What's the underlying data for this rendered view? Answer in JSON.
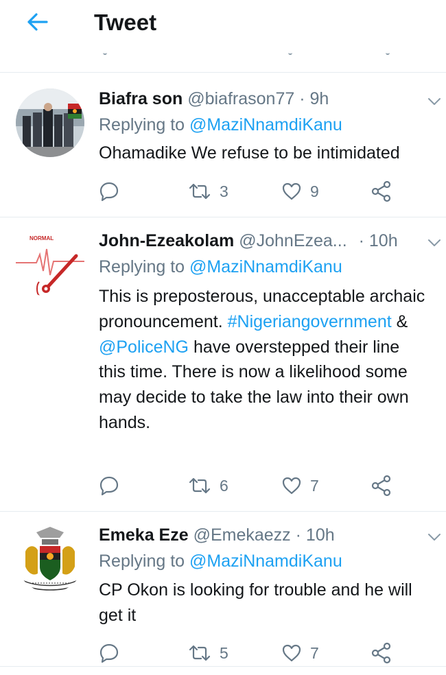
{
  "header": {
    "title": "Tweet",
    "back_icon": "arrow-left-icon"
  },
  "colors": {
    "accent": "#1da1f2",
    "muted": "#657786",
    "text": "#14171a",
    "divider": "#e6ecf0"
  },
  "tweets": [
    {
      "name": "Biafra son",
      "handle": "@biafrason77",
      "time": "· 9h",
      "replying_prefix": "Replying to",
      "replying_to": "@MaziNnamdiKanu",
      "text": "Ohamadike We refuse to be intimidated",
      "replies": "",
      "retweets": "3",
      "likes": "9"
    },
    {
      "name": "John-Ezeakolam",
      "handle": "@JohnEzea...",
      "time": "· 10h",
      "replying_prefix": "Replying to",
      "replying_to": "@MaziNnamdiKanu",
      "text_1": "This is preposterous, unacceptable archaic pronouncement.",
      "hashtag": "#Nigeriangovernment",
      "amp": "&",
      "mention": "@PoliceNG",
      "text_2": "have overstepped their line this time. There is now a likelihood some may decide to take the law into their own hands.",
      "avatar_label": "NORMAL",
      "replies": "",
      "retweets": "6",
      "likes": "7"
    },
    {
      "name": "Emeka Eze",
      "handle": "@Emekaezz",
      "time": "· 10h",
      "replying_prefix": "Replying to",
      "replying_to": "@MaziNnamdiKanu",
      "text": "CP Okon is looking for trouble and he will get it",
      "replies": "",
      "retweets": "5",
      "likes": "7"
    }
  ]
}
